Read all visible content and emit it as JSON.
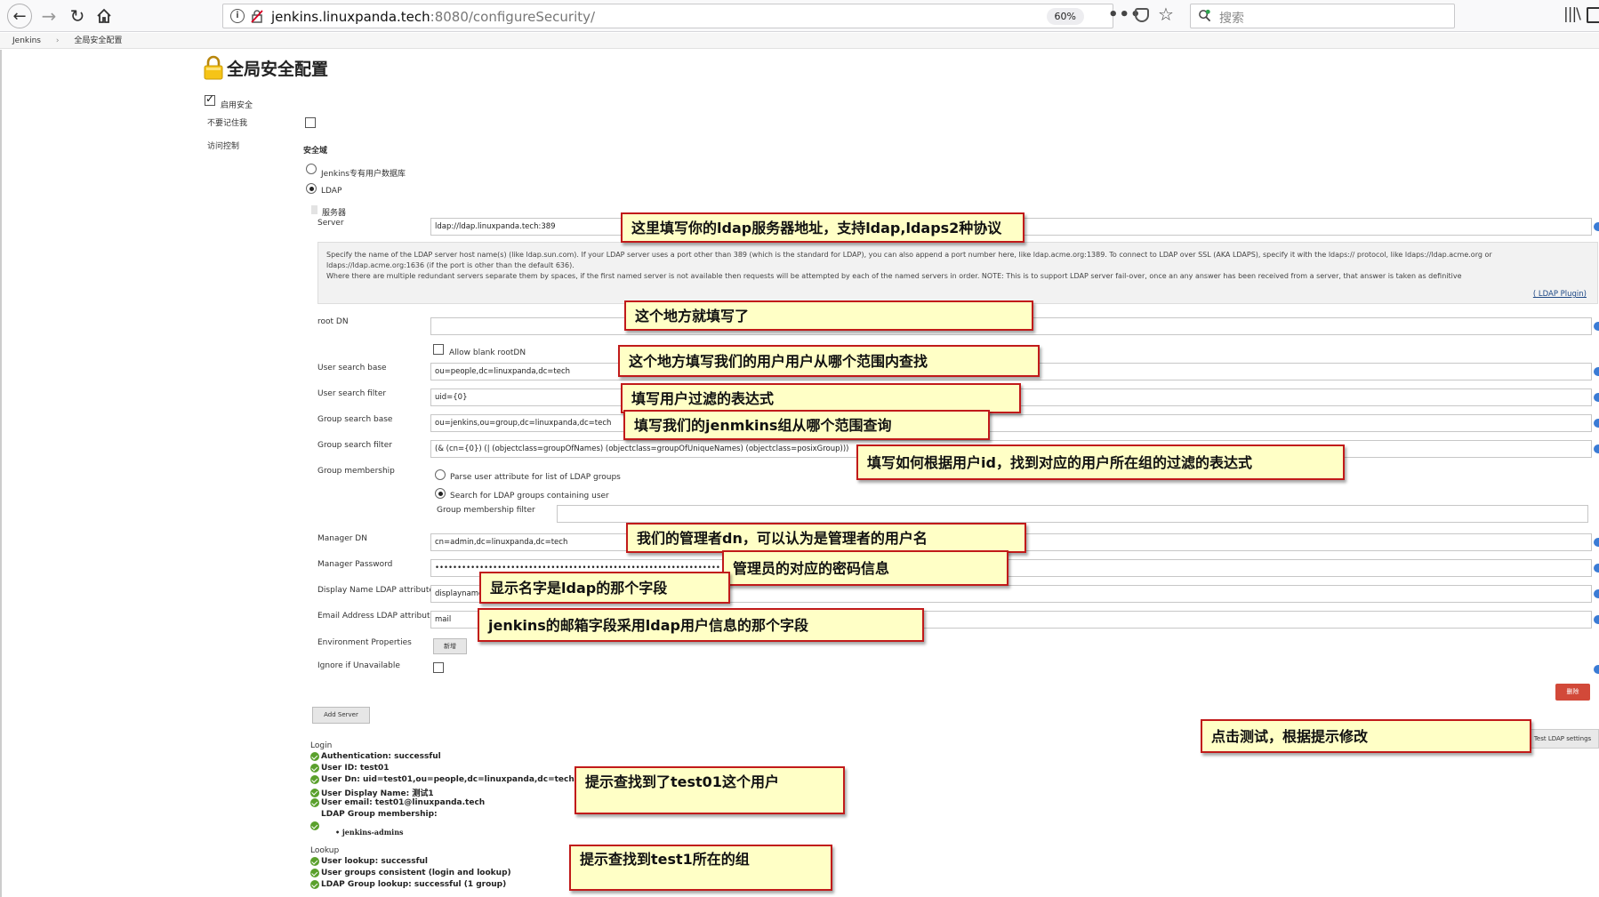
{
  "browser": {
    "url_host": "jenkins.linuxpanda.tech",
    "url_rest": ":8080/configureSecurity/",
    "zoom": "60%",
    "search_placeholder": "搜索",
    "page_actions": "•••"
  },
  "breadcrumb": [
    "Jenkins",
    "全局安全配置"
  ],
  "page": {
    "title": "全局安全配置",
    "enable_security": "启用安全",
    "dont_remember": "不要记住我",
    "access_control": "访问控制",
    "security_realm": "安全域",
    "realm_jenkins_db": "Jenkins专有用户数据库",
    "realm_ldap": "LDAP",
    "server_section": "服务器"
  },
  "form": {
    "server_label": "Server",
    "server_value": "ldap://ldap.linuxpanda.tech:389",
    "server_help_1": "Specify the name of the LDAP server host name(s) (like ldap.sun.com). If your LDAP server uses a port other than 389 (which is the standard for LDAP), you can also append a port number here, like ldap.acme.org:1389. To connect to LDAP over SSL (AKA LDAPS), specify it with the ldaps:// protocol, like ldaps://ldap.acme.org or",
    "server_help_2": "ldaps://ldap.acme.org:1636 (if the port is other than the default 636).",
    "server_help_3": "Where there are multiple redundant servers separate them by spaces, if the first named server is not available then requests will be attempted by each of the named servers in order. NOTE: This is to support LDAP server fail-over, once an any answer has been received from a server, that answer is taken as definitive",
    "ldap_plugin_link": "( LDAP Plugin)",
    "root_dn_label": "root DN",
    "root_dn_value": "",
    "allow_blank": "Allow blank rootDN",
    "user_search_base_label": "User search base",
    "user_search_base_value": "ou=people,dc=linuxpanda,dc=tech",
    "user_search_filter_label": "User search filter",
    "user_search_filter_value": "uid={0}",
    "group_search_base_label": "Group search base",
    "group_search_base_value": "ou=jenkins,ou=group,dc=linuxpanda,dc=tech",
    "group_search_filter_label": "Group search filter",
    "group_search_filter_value": "(& (cn={0}) (| (objectclass=groupOfNames) (objectclass=groupOfUniqueNames) (objectclass=posixGroup)))",
    "group_membership_label": "Group membership",
    "membership_opt_1": "Parse user attribute for list of LDAP groups",
    "membership_opt_2": "Search for LDAP groups containing user",
    "membership_filter_label": "Group membership filter",
    "membership_filter_value": "",
    "manager_dn_label": "Manager DN",
    "manager_dn_value": "cn=admin,dc=linuxpanda,dc=tech",
    "manager_pw_label": "Manager Password",
    "manager_pw_value": "••••••••••••••••••••••••••••••••••••••••••••••••••••••••••••••••",
    "display_name_label": "Display Name LDAP attribute",
    "display_name_value": "displayname",
    "email_label": "Email Address LDAP attribute",
    "email_value": "mail",
    "env_props_label": "Environment Properties",
    "env_add_btn": "新增",
    "ignore_label": "Ignore if Unavailable",
    "delete_btn": "删除",
    "add_server_btn": "Add Server",
    "test_btn": "Test LDAP settings"
  },
  "results": {
    "login_head": "Login",
    "auth": "Authentication: successful",
    "user_id": "User ID: test01",
    "user_dn": "User Dn: uid=test01,ou=people,dc=linuxpanda,dc=tech",
    "display_name": "User Display Name: 测试1",
    "email": "User email: test01@linuxpanda.tech",
    "group_membership": "LDAP Group membership:",
    "group_item": "• jenkins-admins",
    "lookup_head": "Lookup",
    "user_lookup": "User lookup: successful",
    "groups_consistent": "User groups consistent (login and lookup)",
    "group_lookup": "LDAP Group lookup: successful (1 group)"
  },
  "callouts": {
    "server": "这里填写你的ldap服务器地址，支持ldap,ldaps2种协议",
    "root_dn": "这个地方就填写了",
    "user_base": "这个地方填写我们的用户用户从哪个范围内查找",
    "user_filter": "填写用户过滤的表达式",
    "group_base": "填写我们的jenmkins组从哪个范围查询",
    "group_filter": "填写如何根据用户id，找到对应的用户所在组的过滤的表达式",
    "manager_dn": "我们的管理者dn，可以认为是管理者的用户名",
    "manager_pw": "管理员的对应的密码信息",
    "display_name": "显示名字是ldap的那个字段",
    "email": "jenkins的邮箱字段采用ldap用户信息的那个字段",
    "test": "点击测试，根据提示修改",
    "found_user": "提示查找到了test01这个用户",
    "found_group": "提示查找到test1所在的组"
  }
}
